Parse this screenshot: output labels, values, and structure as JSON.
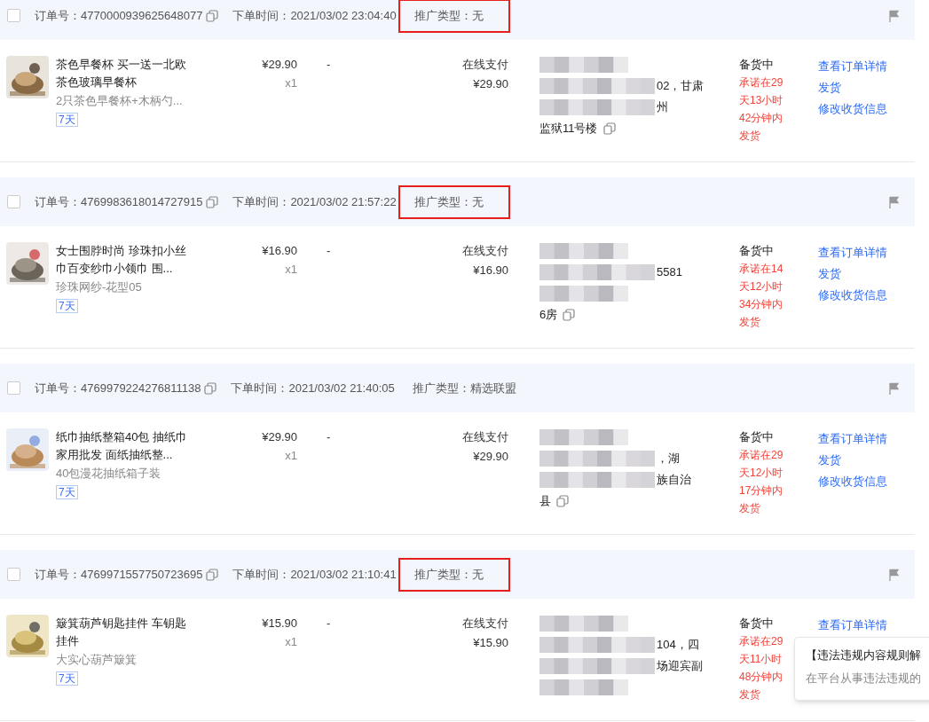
{
  "orders": [
    {
      "order_no": "订单号：4770000939625648077",
      "order_time": "下单时间：2021/03/02 23:04:40",
      "promo": "推广类型：无",
      "highlighted": true,
      "checked": false,
      "product": {
        "title": "茶色早餐杯 买一送一北欧茶色玻璃早餐杯",
        "sku": "2只茶色早餐杯+木柄勺...",
        "tag": "7天"
      },
      "price": "¥29.90",
      "qty": "x1",
      "discount": "-",
      "pay_method": "在线支付",
      "pay_amount": "¥29.90",
      "address": [
        {
          "kind": "blurred"
        },
        {
          "kind": "text",
          "text": "02，甘肃"
        },
        {
          "kind": "text",
          "text": "州"
        },
        {
          "kind": "text",
          "text": "监狱11号楼"
        }
      ],
      "status": "备货中",
      "deadline": [
        "承诺在29",
        "天13小时",
        "42分钟内",
        "发货"
      ],
      "actions": [
        "查看订单详情",
        "发货",
        "修改收货信息"
      ]
    },
    {
      "order_no": "订单号：4769983618014727915",
      "order_time": "下单时间：2021/03/02 21:57:22",
      "promo": "推广类型：无",
      "highlighted": true,
      "checked": false,
      "product": {
        "title": "女士围脖时尚 珍珠扣小丝巾百变纱巾小领巾 围...",
        "sku": "珍珠网纱-花型05",
        "tag": "7天"
      },
      "price": "¥16.90",
      "qty": "x1",
      "discount": "-",
      "pay_method": "在线支付",
      "pay_amount": "¥16.90",
      "address": [
        {
          "kind": "blurred"
        },
        {
          "kind": "text",
          "text": "5581"
        },
        {
          "kind": "blurred"
        },
        {
          "kind": "text",
          "text": "6房"
        }
      ],
      "status": "备货中",
      "deadline": [
        "承诺在14",
        "天12小时",
        "34分钟内",
        "发货"
      ],
      "actions": [
        "查看订单详情",
        "发货",
        "修改收货信息"
      ]
    },
    {
      "order_no": "订单号：4769979224276811138",
      "order_time": "下单时间：2021/03/02 21:40:05",
      "promo": "推广类型：精选联盟",
      "highlighted": false,
      "checked": false,
      "product": {
        "title": "纸巾抽纸整箱40包 抽纸巾家用批发 面纸抽纸整...",
        "sku": "40包漫花抽纸箱子装",
        "tag": "7天"
      },
      "price": "¥29.90",
      "qty": "x1",
      "discount": "-",
      "pay_method": "在线支付",
      "pay_amount": "¥29.90",
      "address": [
        {
          "kind": "blurred"
        },
        {
          "kind": "text",
          "text": "，湖"
        },
        {
          "kind": "text",
          "text": "族自治"
        },
        {
          "kind": "text",
          "text": "县"
        }
      ],
      "status": "备货中",
      "deadline": [
        "承诺在29",
        "天12小时",
        "17分钟内",
        "发货"
      ],
      "actions": [
        "查看订单详情",
        "发货",
        "修改收货信息"
      ]
    },
    {
      "order_no": "订单号：4769971557750723695",
      "order_time": "下单时间：2021/03/02 21:10:41",
      "promo": "推广类型：无",
      "highlighted": true,
      "checked": false,
      "product": {
        "title": "簸箕葫芦钥匙挂件 车钥匙挂件",
        "sku": "大实心葫芦簸箕",
        "tag": "7天"
      },
      "price": "¥15.90",
      "qty": "x1",
      "discount": "-",
      "pay_method": "在线支付",
      "pay_amount": "¥15.90",
      "address": [
        {
          "kind": "blurred"
        },
        {
          "kind": "text",
          "text": "104，四"
        },
        {
          "kind": "text",
          "text": "场迎宾副"
        },
        {
          "kind": "blurred"
        }
      ],
      "status": "备货中",
      "deadline": [
        "承诺在29",
        "天11小时",
        "48分钟内",
        "发货"
      ],
      "actions": [
        "查看订单详情"
      ]
    }
  ],
  "popup": {
    "title": "【违法违规内容规则解",
    "text": "在平台从事违法违规的"
  }
}
